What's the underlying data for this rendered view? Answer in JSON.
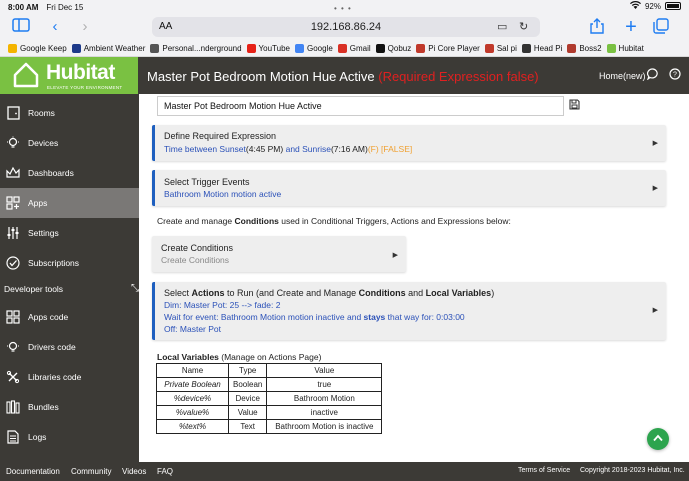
{
  "status_bar": {
    "time": "8:00 AM",
    "date": "Fri Dec 15",
    "battery": "92%"
  },
  "browser": {
    "aa_label": "AA",
    "url": "192.168.86.24",
    "favorites": [
      {
        "label": "Google Keep",
        "color": "#f4b400"
      },
      {
        "label": "Ambient Weather",
        "color": "#1e3a8a"
      },
      {
        "label": "Personal...nderground",
        "color": "#555555"
      },
      {
        "label": "YouTube",
        "color": "#e62117"
      },
      {
        "label": "Google",
        "color": "#4285f4"
      },
      {
        "label": "Gmail",
        "color": "#d93025"
      },
      {
        "label": "Qobuz",
        "color": "#111111"
      },
      {
        "label": "Pi Core Player",
        "color": "#c0392b"
      },
      {
        "label": "Sal pi",
        "color": "#c0392b"
      },
      {
        "label": "Head Pi",
        "color": "#333333"
      },
      {
        "label": "Boss2",
        "color": "#b03a2e"
      },
      {
        "label": "Hubitat",
        "color": "#7ac142"
      }
    ]
  },
  "header": {
    "logo_text": "Hubitat",
    "logo_tagline": "ELEVATE YOUR ENVIRONMENT",
    "title": "Master Pot Bedroom Motion Hue Active",
    "title_warning": "(Required Expression false)",
    "home_link": "Home(new)",
    "accent_color": "#7ac142"
  },
  "sidebar": {
    "items": [
      {
        "label": "Rooms",
        "icon": "rooms-icon"
      },
      {
        "label": "Devices",
        "icon": "devices-icon"
      },
      {
        "label": "Dashboards",
        "icon": "dashboards-icon"
      },
      {
        "label": "Apps",
        "icon": "apps-icon",
        "active": true
      },
      {
        "label": "Settings",
        "icon": "settings-icon"
      },
      {
        "label": "Subscriptions",
        "icon": "subscriptions-icon"
      }
    ],
    "section_label": "Developer tools",
    "dev_items": [
      {
        "label": "Apps code",
        "icon": "apps-code-icon"
      },
      {
        "label": "Drivers code",
        "icon": "drivers-code-icon"
      },
      {
        "label": "Libraries code",
        "icon": "libraries-code-icon"
      },
      {
        "label": "Bundles",
        "icon": "bundles-icon"
      },
      {
        "label": "Logs",
        "icon": "logs-icon"
      }
    ]
  },
  "main": {
    "name_value": "Master Pot Bedroom Motion Hue Active",
    "required_expression": {
      "title": "Define Required Expression",
      "line_a": "Time between Sunset",
      "line_b": "(4:45 PM)",
      "line_c": " and Sunrise",
      "line_d": "(7:16 AM)",
      "line_e": "(F) [FALSE]"
    },
    "trigger": {
      "title": "Select Trigger Events",
      "subtitle": "Bathroom Motion motion active"
    },
    "help_prefix": "Create and manage ",
    "help_bold": "Conditions",
    "help_suffix": " used in Conditional Triggers, Actions and Expressions below:",
    "conditions": {
      "title": "Create Conditions",
      "subtitle": "Create Conditions"
    },
    "actions": {
      "title_a": "Select ",
      "title_b": "Actions",
      "title_c": " to Run (and Create and Manage ",
      "title_d": "Conditions",
      "title_e": " and ",
      "title_f": "Local Variables",
      "title_g": ")",
      "line1": "Dim: Master Pot: 25 --> fade: 2",
      "line2_a": "Wait for event: Bathroom Motion motion inactive and ",
      "line2_b": "stays",
      "line2_c": " that way for: 0:03:00",
      "line3": "Off: Master Pot"
    },
    "local_vars_title": "Local Variables",
    "local_vars_note": " (Manage on Actions Page)",
    "table": {
      "headers": [
        "Name",
        "Type",
        "Value"
      ],
      "rows": [
        [
          "Private Boolean",
          "Boolean",
          "true"
        ],
        [
          "%device%",
          "Device",
          "Bathroom Motion"
        ],
        [
          "%value%",
          "Value",
          "inactive"
        ],
        [
          "%text%",
          "Text",
          "Bathroom Motion is inactive"
        ]
      ]
    }
  },
  "footer": {
    "links": [
      "Documentation",
      "Community",
      "Videos",
      "FAQ"
    ],
    "terms": "Terms of Service",
    "copyright": "Copyright 2018-2023 Hubitat, Inc."
  }
}
